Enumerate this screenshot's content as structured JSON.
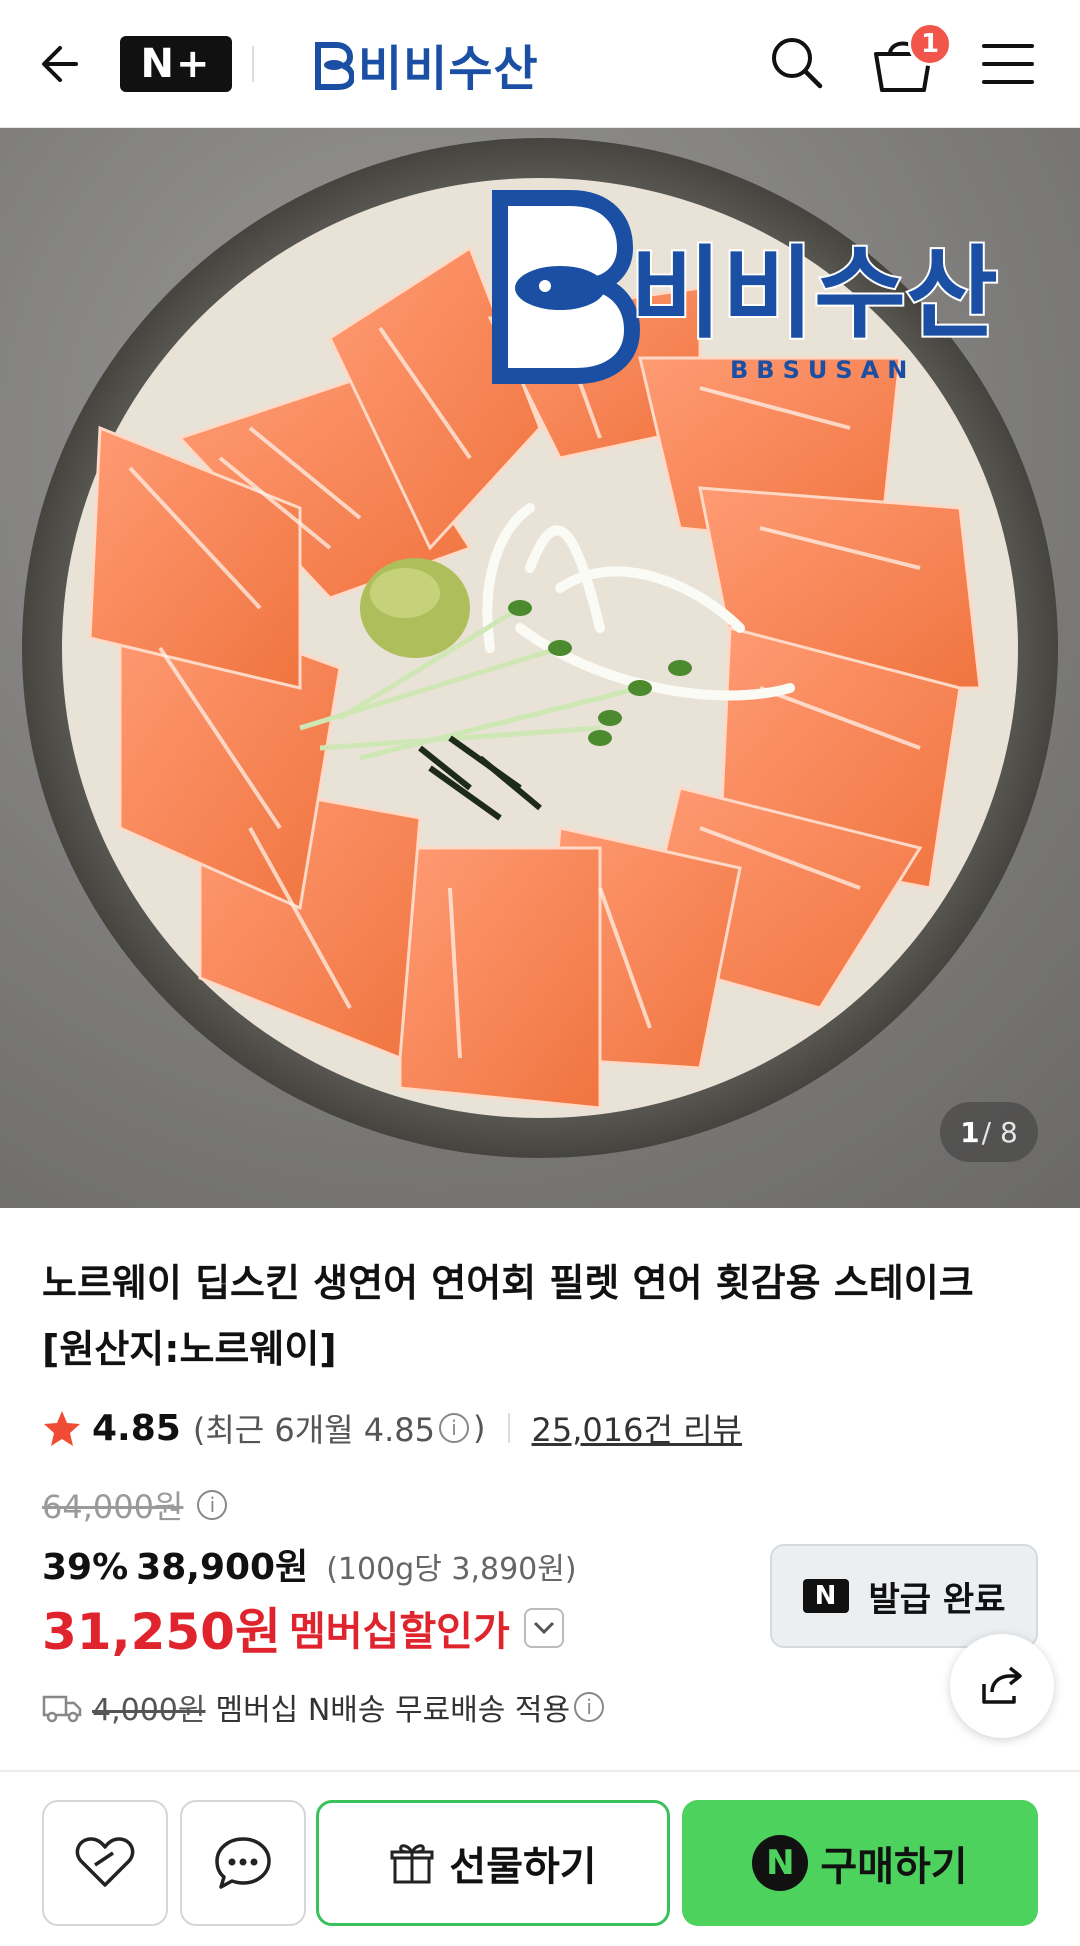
{
  "header": {
    "nplus_label": "N+",
    "brand_name": "비비수산",
    "cart_count": "1"
  },
  "hero": {
    "watermark_brand": "비비수산",
    "watermark_sub": "BBSUSAN",
    "counter_current": "1",
    "counter_total": "/ 8"
  },
  "product": {
    "title": "노르웨이 딥스킨 생연어 연어회 필렛 연어 횟감용 스테이크 [원산지:노르웨이]",
    "rating": "4.85",
    "recent_rating_prefix": "(최근 6개월 4.85",
    "recent_rating_suffix": ")",
    "review_count": "25,016건 리뷰",
    "original_price": "64,000원",
    "discount_rate": "39%",
    "sale_price": "38,900원",
    "unit_price": "(100g당 3,890원)",
    "member_price": "31,250원",
    "member_label": "멤버십할인가",
    "coupon_label": "발급 완료",
    "shipping_original": "4,000원",
    "shipping_text": "멤버십 N배송 무료배송 적용"
  },
  "actions": {
    "gift_label": "선물하기",
    "buy_label": "구매하기"
  },
  "colors": {
    "brand": "#1b4fa3",
    "accent_red": "#e0242d",
    "buy_green": "#4ed25e",
    "gift_border": "#3bc15b"
  }
}
